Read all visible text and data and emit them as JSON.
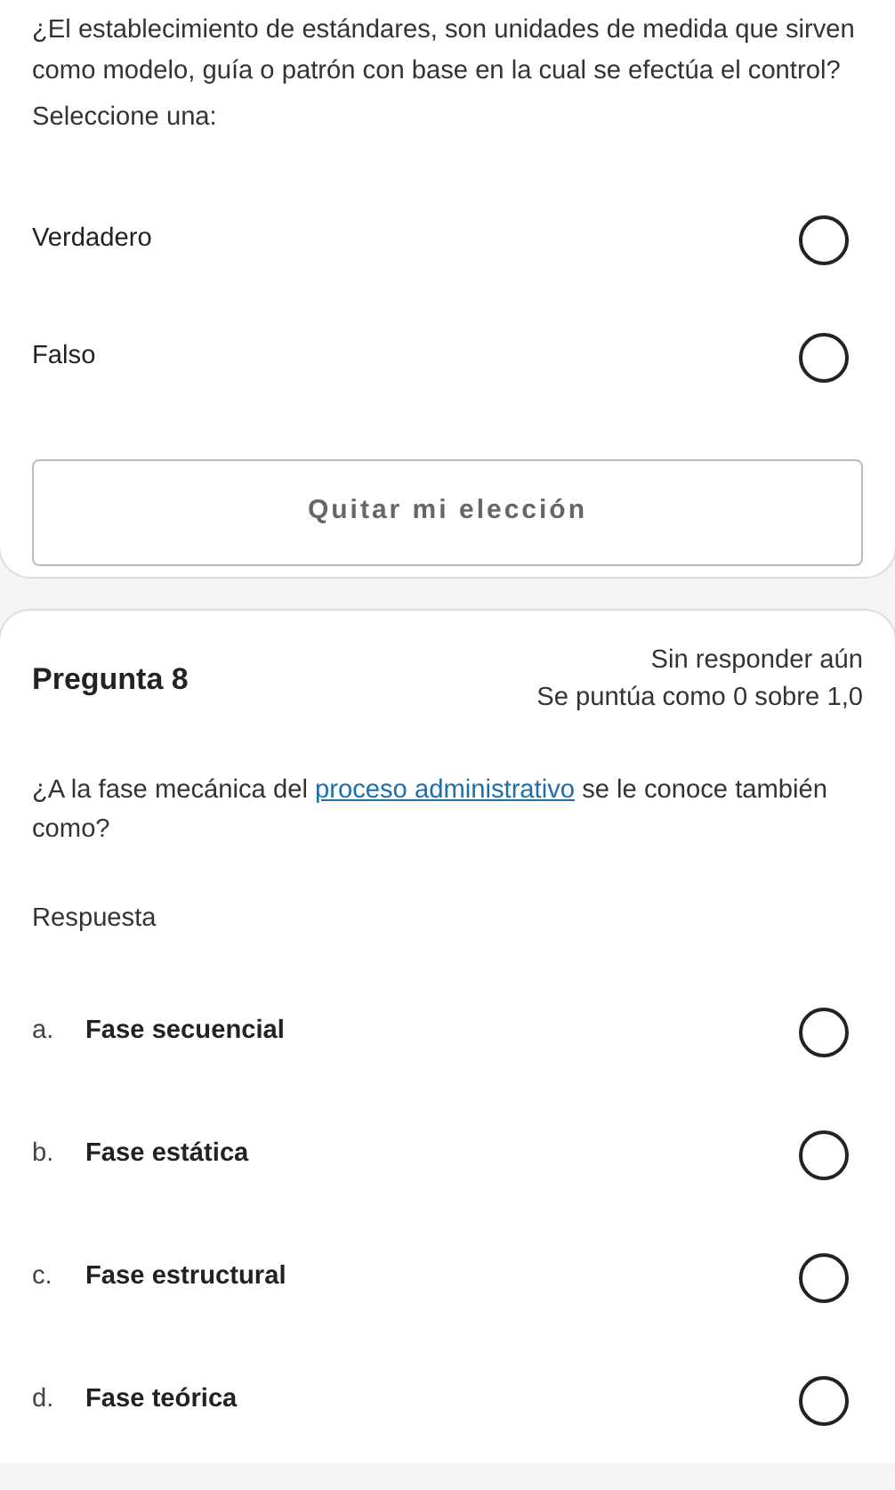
{
  "previous_question": {
    "text": "¿El establecimiento de estándares, son unidades de medida que sirven como modelo, guía o patrón con base en la cual se efectúa el control?",
    "prompt": "Seleccione una:",
    "options": [
      {
        "label": "Verdadero",
        "selected": false
      },
      {
        "label": "Falso",
        "selected": false
      }
    ],
    "clear_button": "Quitar mi elección"
  },
  "question": {
    "title": "Pregunta 8",
    "status": "Sin responder aún",
    "grade": "Se puntúa como 0 sobre 1,0",
    "text_before": "¿A la fase mecánica del ",
    "link": "proceso administrativo",
    "text_after": " se le conoce también como?",
    "answer_label": "Respuesta",
    "options": [
      {
        "letter": "a.",
        "label": "Fase secuencial",
        "selected": false
      },
      {
        "letter": "b.",
        "label": "Fase estática",
        "selected": false
      },
      {
        "letter": "c.",
        "label": "Fase estructural",
        "selected": false
      },
      {
        "letter": "d.",
        "label": "Fase teórica",
        "selected": false
      }
    ]
  }
}
